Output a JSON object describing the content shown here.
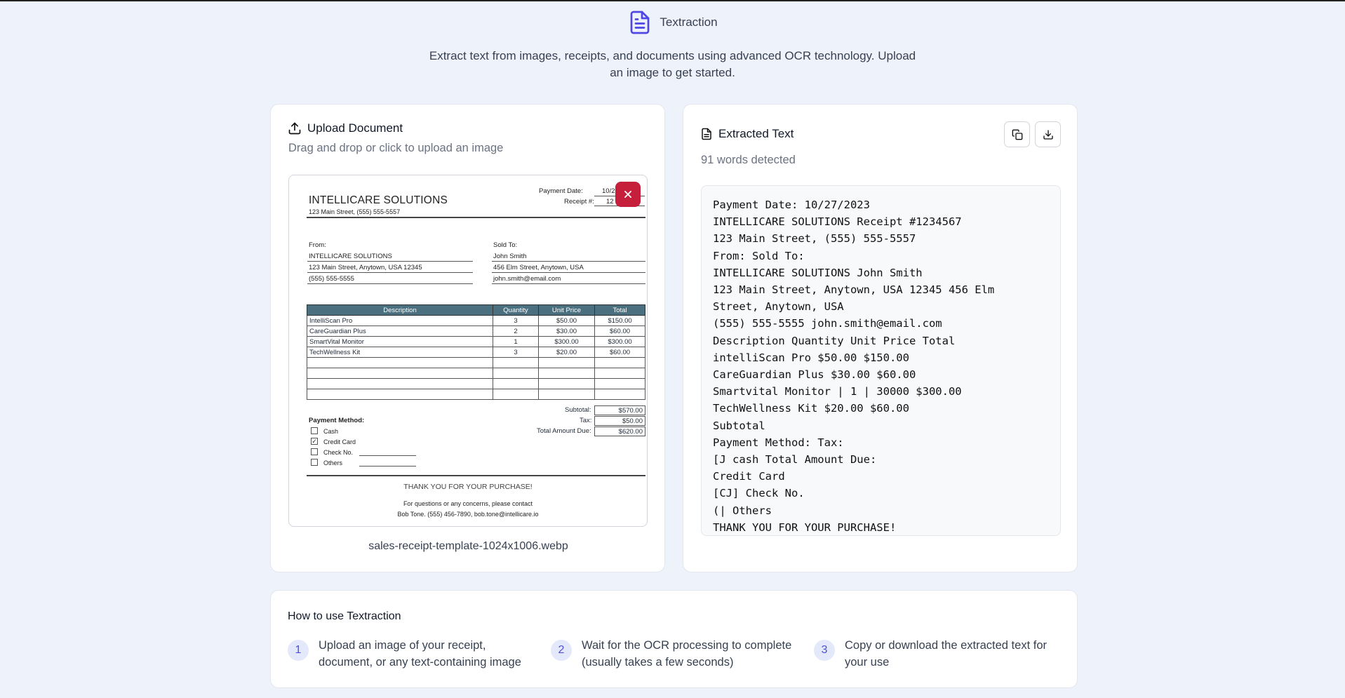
{
  "app": {
    "title": "Textraction",
    "description_line1": "Extract text from images, receipts, and documents using advanced OCR technology. Upload",
    "description_line2": "an image to get started.",
    "accent_color": "#4f46e5"
  },
  "upload": {
    "heading": "Upload Document",
    "subheading": "Drag and drop or click to upload an image",
    "filename": "sales-receipt-template-1024x1006.webp",
    "remove_icon": "close-icon",
    "receipt": {
      "company": "INTELLICARE SOLUTIONS",
      "address": "123 Main Street, (555) 555-5557",
      "payment_date_label": "Payment Date:",
      "payment_date_value": "10/2",
      "receipt_label": "Receipt #:",
      "receipt_value": "12",
      "from_label": "From:",
      "from_lines": [
        "INTELLICARE SOLUTIONS",
        "123 Main Street, Anytown, USA 12345",
        "(555) 555-5555"
      ],
      "sold_to_label": "Sold To:",
      "sold_to_lines": [
        "John Smith",
        "456 Elm Street, Anytown, USA",
        "john.smith@email.com"
      ],
      "columns": [
        "Description",
        "Quantity",
        "Unit Price",
        "Total"
      ],
      "rows": [
        [
          "IntelliScan Pro",
          "3",
          "$50.00",
          "$150.00"
        ],
        [
          "CareGuardian Plus",
          "2",
          "$30.00",
          "$60.00"
        ],
        [
          "SmartVital Monitor",
          "1",
          "$300.00",
          "$300.00"
        ],
        [
          "TechWellness Kit",
          "3",
          "$20.00",
          "$60.00"
        ],
        [
          "",
          "",
          "",
          ""
        ],
        [
          "",
          "",
          "",
          ""
        ],
        [
          "",
          "",
          "",
          ""
        ],
        [
          "",
          "",
          "",
          ""
        ]
      ],
      "subtotal_label": "Subtotal:",
      "subtotal_value": "$570.00",
      "tax_label": "Tax:",
      "tax_value": "$50.00",
      "total_label": "Total Amount Due:",
      "total_value": "$620.00",
      "payment_method_label": "Payment Method:",
      "methods": [
        "Cash",
        "Credit Card",
        "Check No.",
        "Others"
      ],
      "thanks": "THANK YOU FOR YOUR PURCHASE!",
      "contact_line1": "For questions or any concerns, please contact",
      "contact_line2": "Bob Tone. (555) 456-7890, bob.tone@intellicare.io"
    }
  },
  "extracted": {
    "heading": "Extracted Text",
    "word_count": "91 words detected",
    "copy_icon": "copy-icon",
    "download_icon": "download-icon",
    "lines": [
      "Payment Date: 10/27/2023",
      "INTELLICARE SOLUTIONS Receipt #1234567",
      "123 Main Street, (555) 555-5557",
      "From: Sold To:",
      "INTELLICARE SOLUTIONS John Smith",
      "123 Main Street, Anytown, USA 12345 456 Elm",
      "Street, Anytown, USA",
      "(555) 555-5555 john.smith@email.com",
      "Description Quantity Unit Price Total",
      "intelliScan Pro $50.00 $150.00",
      "CareGuardian Plus $30.00 $60.00",
      "Smartvital Monitor | 1 | 30000 $300.00",
      "TechWellness Kit $20.00 $60.00",
      "Subtotal",
      "Payment Method: Tax:",
      "[J cash Total Amount Due:",
      "Credit Card",
      "[CJ] Check No.",
      "(| Others",
      "THANK YOU FOR YOUR PURCHASE!"
    ]
  },
  "howto": {
    "title": "How to use Textraction",
    "steps": [
      {
        "num": "1",
        "line1": "Upload an image of your receipt,",
        "line2": "document, or any text-containing image"
      },
      {
        "num": "2",
        "line1": "Wait for the OCR processing to complete",
        "line2": "(usually takes a few seconds)"
      },
      {
        "num": "3",
        "line1": "Copy or download the extracted text for",
        "line2": "your use"
      }
    ]
  }
}
